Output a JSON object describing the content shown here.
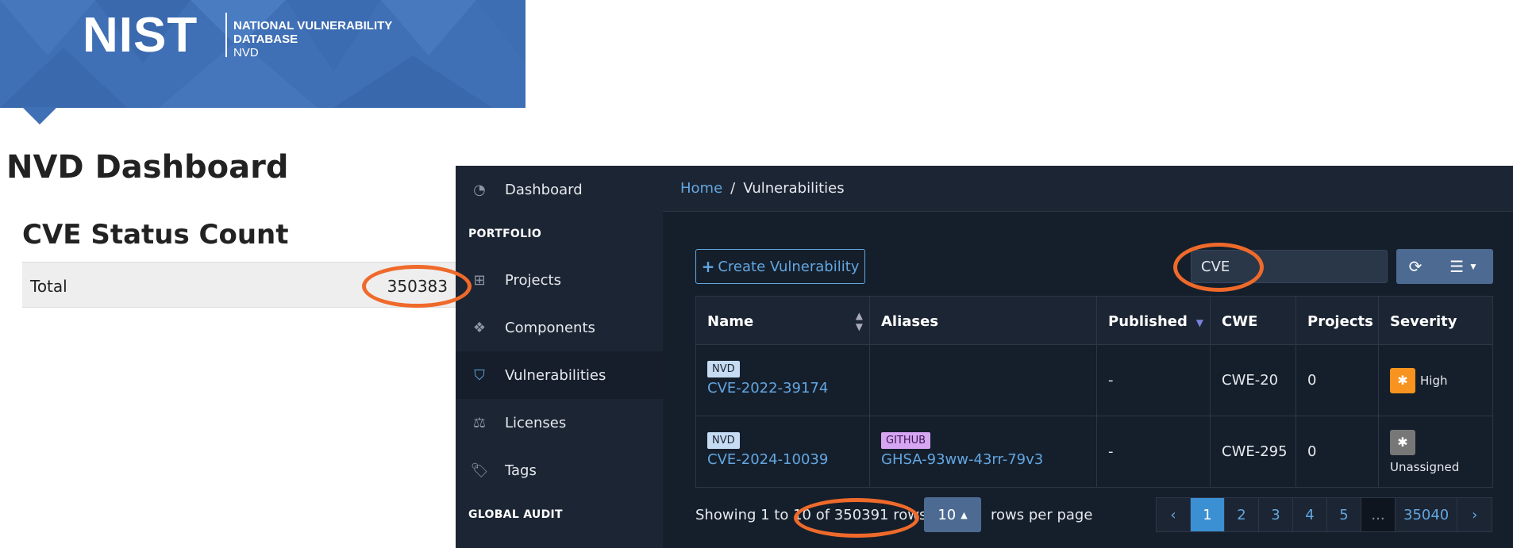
{
  "nist": {
    "logo_text": "NIST",
    "line1": "NATIONAL VULNERABILITY",
    "line2": "DATABASE",
    "line3": "NVD"
  },
  "nvd": {
    "title": "NVD Dashboard",
    "section": "CVE Status Count",
    "total_label": "Total",
    "total_value": "350383"
  },
  "sidebar": {
    "dashboard": "Dashboard",
    "portfolio_heading": "PORTFOLIO",
    "projects": "Projects",
    "components": "Components",
    "vulnerabilities": "Vulnerabilities",
    "licenses": "Licenses",
    "tags": "Tags",
    "global_audit_heading": "GLOBAL AUDIT"
  },
  "breadcrumb": {
    "home": "Home",
    "sep": "/",
    "current": "Vulnerabilities"
  },
  "toolbar": {
    "create_label": "Create Vulnerability",
    "search_value": "CVE"
  },
  "table": {
    "headers": [
      "Name",
      "Aliases",
      "Published",
      "CWE",
      "Projects",
      "Severity"
    ],
    "rows": [
      {
        "source": "NVD",
        "name": "CVE-2022-39174",
        "alias_source": "",
        "alias": "",
        "published": "-",
        "cwe": "CWE-20",
        "projects": "0",
        "severity": "High"
      },
      {
        "source": "NVD",
        "name": "CVE-2024-10039",
        "alias_source": "GITHUB",
        "alias": "GHSA-93ww-43rr-79v3",
        "published": "-",
        "cwe": "CWE-295",
        "projects": "0",
        "severity": "Unassigned"
      }
    ]
  },
  "footer": {
    "showing": "Showing 1 to 10 of 350391 rows",
    "per_page": "10",
    "rows_per_page": "rows per page",
    "pages": [
      "‹",
      "1",
      "2",
      "3",
      "4",
      "5",
      "...",
      "35040",
      "›"
    ]
  },
  "colors": {
    "accent": "#63a6e0",
    "highlight_ring": "#ef6a2a",
    "nist_blue": "#3f6fb5"
  }
}
